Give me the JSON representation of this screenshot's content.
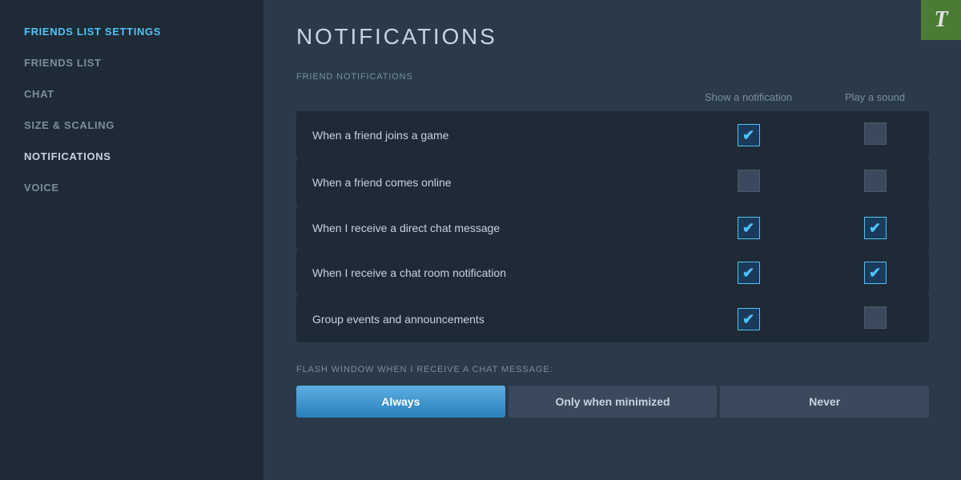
{
  "sidebar": {
    "items": [
      {
        "id": "friends-list-settings",
        "label": "FRIENDS LIST SETTINGS",
        "active": true,
        "bold": false
      },
      {
        "id": "friends-list",
        "label": "FRIENDS LIST",
        "active": false,
        "bold": false
      },
      {
        "id": "chat",
        "label": "CHAT",
        "active": false,
        "bold": false
      },
      {
        "id": "size-scaling",
        "label": "SIZE & SCALING",
        "active": false,
        "bold": false
      },
      {
        "id": "notifications",
        "label": "NOTIFICATIONS",
        "active": false,
        "bold": true
      },
      {
        "id": "voice",
        "label": "VOICE",
        "active": false,
        "bold": false
      }
    ]
  },
  "main": {
    "title": "NOTIFICATIONS",
    "close_button": "×",
    "section_friend_notifications": "FRIEND NOTIFICATIONS",
    "col_show_notification": "Show a notification",
    "col_play_sound": "Play a sound",
    "rows": [
      {
        "label": "When a friend joins a game",
        "show_notification": true,
        "play_sound": false
      },
      {
        "label": "When a friend comes online",
        "show_notification": false,
        "play_sound": false
      },
      {
        "label": "When I receive a direct chat message",
        "show_notification": true,
        "play_sound": true
      },
      {
        "label": "When I receive a chat room notification",
        "show_notification": true,
        "play_sound": true
      },
      {
        "label": "Group events and announcements",
        "show_notification": true,
        "play_sound": false
      }
    ],
    "flash_window_label": "FLASH WINDOW WHEN I RECEIVE A CHAT MESSAGE:",
    "flash_buttons": [
      {
        "id": "always",
        "label": "Always",
        "active": true
      },
      {
        "id": "only-when-minimized",
        "label": "Only when minimized",
        "active": false
      },
      {
        "id": "never",
        "label": "Never",
        "active": false
      }
    ]
  },
  "steam_logo": "T"
}
